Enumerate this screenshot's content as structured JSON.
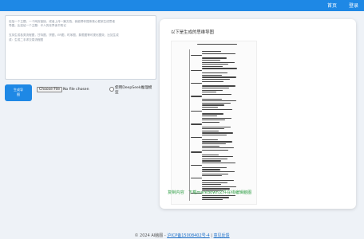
{
  "nav": {
    "home": "首页",
    "login": "登录"
  },
  "input": {
    "lines": [
      "包括一个主题，一个网页链接，或者上传一篇文档，我能帮你提炼核心框架生成思维",
      "导图。比如给一个主题：半人的世界读书笔记",
      "",
      "支持生成各类流程图，甘特图，饼图，ER图，时序图，象限图等可视化图效，比如生成",
      "成：生成二手求交易流程图"
    ]
  },
  "controls": {
    "generate_line1": "生成导",
    "generate_line2": "图",
    "file_button": "Choose File",
    "file_status": "No file chosen",
    "deepseek_label": "使用DeepSeek推理模型"
  },
  "result": {
    "title": "以下是生成的思维导图",
    "actions": {
      "copy": "复制内容",
      "download": "下载markdown文件",
      "edit": "在线编辑脑图"
    }
  },
  "footer": {
    "prefix": "© 2024 AI脑图 - ",
    "icp": "沪ICP备15008402号-4",
    "sep": " | ",
    "feedback": "意见反馈"
  },
  "colors": {
    "nav": "#1e88e5",
    "button": "#1e88e5",
    "action_link": "#2e9e44"
  }
}
